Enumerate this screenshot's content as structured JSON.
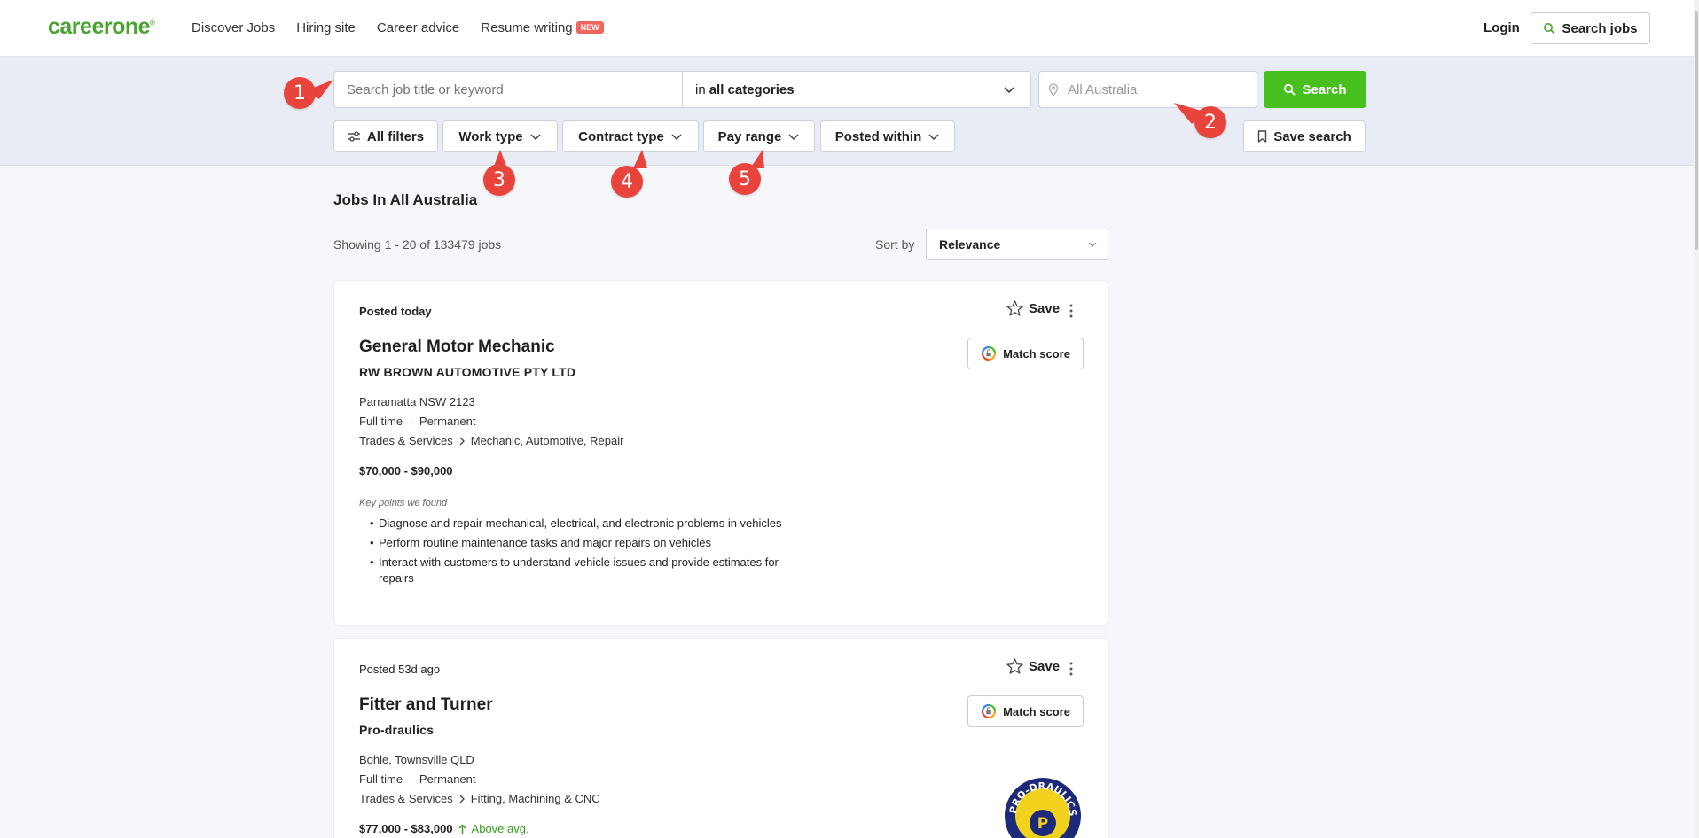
{
  "header": {
    "logo": "careerone",
    "nav": [
      "Discover Jobs",
      "Hiring site",
      "Career advice",
      "Resume writing"
    ],
    "new_badge": "NEW",
    "login": "Login",
    "search_jobs": "Search jobs"
  },
  "search": {
    "keyword_placeholder": "Search job title or keyword",
    "category_prefix": "in",
    "category_value": "all categories",
    "location_placeholder": "All Australia",
    "search_label": "Search"
  },
  "filters": {
    "all_filters": "All filters",
    "work_type": "Work type",
    "contract_type": "Contract type",
    "pay_range": "Pay range",
    "posted_within": "Posted within",
    "save_search": "Save search"
  },
  "markers": [
    "1",
    "2",
    "3",
    "4",
    "5"
  ],
  "results": {
    "title": "Jobs In All Australia",
    "showing": "Showing 1 - 20 of 133479 jobs",
    "sort_label": "Sort by",
    "sort_value": "Relevance"
  },
  "jobs": [
    {
      "posted": "Posted today",
      "save": "Save",
      "match": "Match score",
      "title": "General Motor Mechanic",
      "company": "RW BROWN AUTOMOTIVE PTY LTD",
      "location": "Parramatta NSW 2123",
      "work_type": "Full time",
      "contract": "Permanent",
      "category": "Trades & Services",
      "subcategory": "Mechanic, Automotive, Repair",
      "salary": "$70,000 - $90,000",
      "key_points_label": "Key points we found",
      "key_points": [
        "Diagnose and repair mechanical, electrical, and electronic problems in vehicles",
        "Perform routine maintenance tasks and major repairs on vehicles",
        "Interact with customers to understand vehicle issues and provide estimates for repairs"
      ]
    },
    {
      "posted": "Posted 53d ago",
      "save": "Save",
      "match": "Match score",
      "title": "Fitter and Turner",
      "company": "Pro-draulics",
      "location": "Bohle, Townsville QLD",
      "work_type": "Full time",
      "contract": "Permanent",
      "category": "Trades & Services",
      "subcategory": "Fitting, Machining & CNC",
      "salary": "$77,000 - $83,000",
      "salary_note": "Above avg.",
      "logo_text": "PRO-DRAULICS"
    }
  ],
  "colors": {
    "brand_green": "#4aa22f",
    "search_green": "#47c01f",
    "marker_red": "#e8443c",
    "new_badge": "#f0655d"
  }
}
